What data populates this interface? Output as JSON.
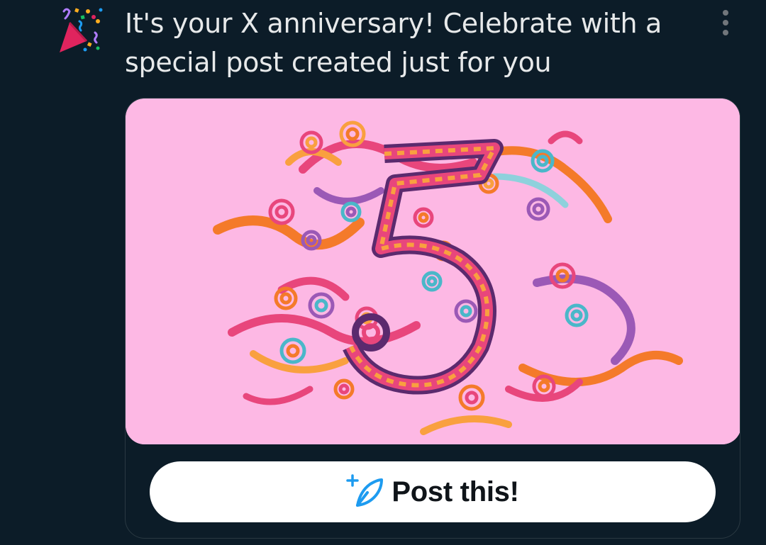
{
  "notification": {
    "icon": "party-popper-icon",
    "text": "It's your X anniversary! Celebrate with a special post created just for you",
    "more_icon": "more-vertical-icon"
  },
  "card": {
    "artwork_number": "5",
    "artwork_background": "#fdb8e4",
    "button": {
      "icon": "compose-post-icon",
      "label": "Post this!"
    }
  },
  "colors": {
    "background": "#0c1c28",
    "text": "#e7e9ea",
    "accent": "#1d9bf0"
  }
}
